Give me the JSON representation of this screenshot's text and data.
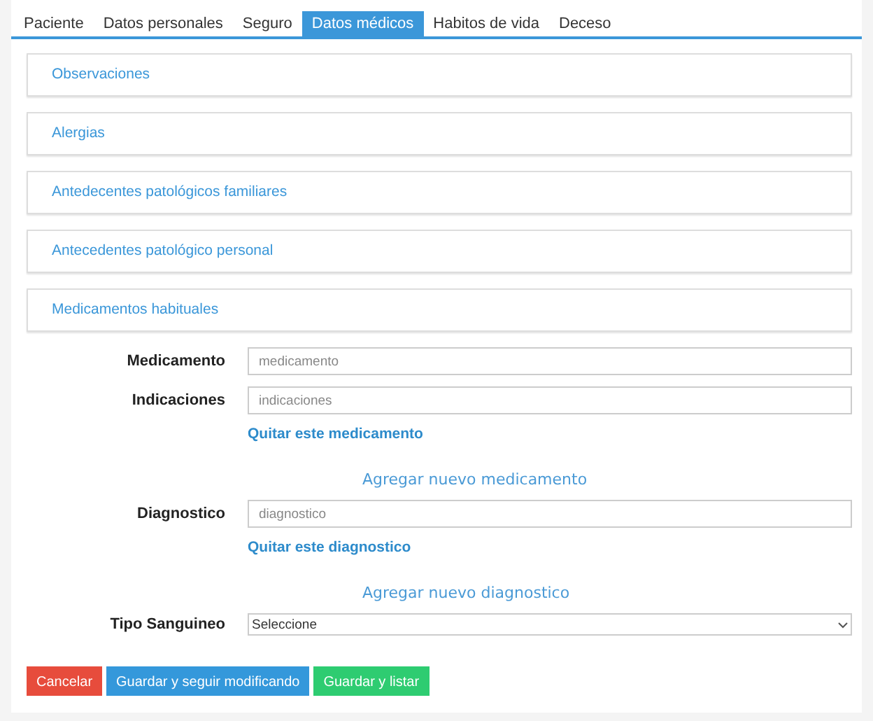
{
  "tabs": [
    {
      "label": "Paciente",
      "selected": false
    },
    {
      "label": "Datos personales",
      "selected": false
    },
    {
      "label": "Seguro",
      "selected": false
    },
    {
      "label": "Datos médicos",
      "selected": true
    },
    {
      "label": "Habitos de vida",
      "selected": false
    },
    {
      "label": "Deceso",
      "selected": false
    }
  ],
  "sections": [
    "Observaciones",
    "Alergias",
    "Antedecentes patológicos familiares",
    "Antecedentes patológico personal",
    "Medicamentos habituales"
  ],
  "form": [
    {
      "kind": "field",
      "label": "Medicamento",
      "placeholder": "medicamento"
    },
    {
      "kind": "field",
      "label": "Indicaciones",
      "placeholder": "indicaciones"
    },
    {
      "kind": "remove",
      "text": "Quitar este medicamento"
    },
    {
      "kind": "add",
      "text": "Agregar nuevo medicamento"
    },
    {
      "kind": "field",
      "label": "Diagnostico",
      "placeholder": "diagnostico"
    },
    {
      "kind": "remove",
      "text": "Quitar este diagnostico"
    },
    {
      "kind": "add",
      "text": "Agregar nuevo diagnostico"
    },
    {
      "kind": "select",
      "label": "Tipo Sanguineo",
      "value": "Seleccione"
    }
  ],
  "buttons": [
    {
      "label": "Cancelar",
      "kind": "danger"
    },
    {
      "label": "Guardar y seguir modificando",
      "kind": "primary"
    },
    {
      "label": "Guardar y listar",
      "kind": "success"
    }
  ]
}
